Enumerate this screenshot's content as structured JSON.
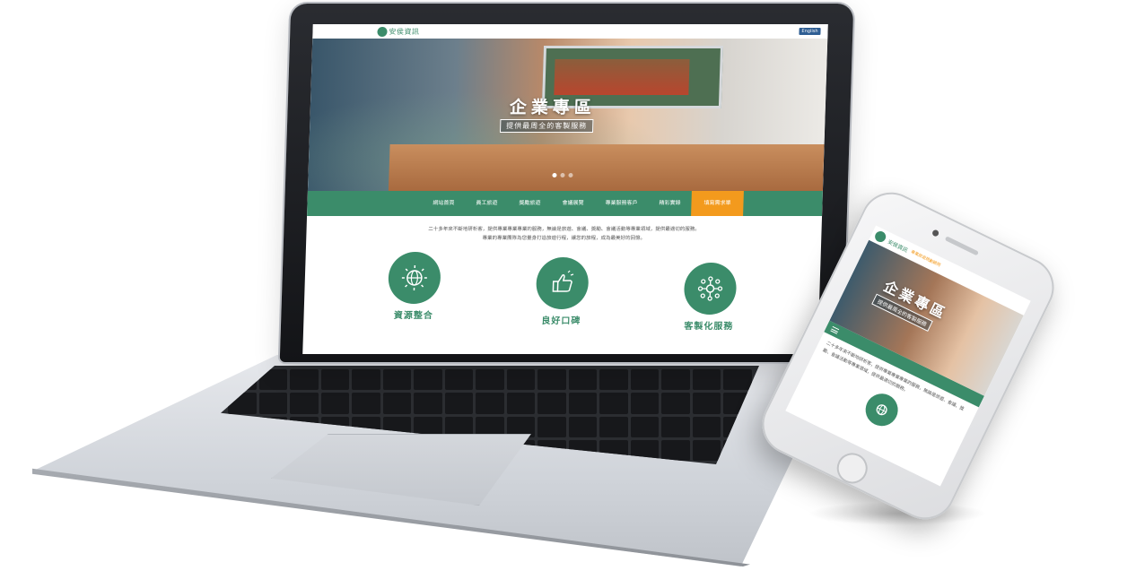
{
  "site": {
    "logo_text": "安侯資訊",
    "lang_button": "English"
  },
  "hero": {
    "title": "企業專區",
    "subtitle": "提供最周全的客製服務"
  },
  "nav": {
    "items": [
      "網站首頁",
      "員工旅遊",
      "獎勵旅遊",
      "會議展覽",
      "專業服務客戶",
      "精彩實錄"
    ],
    "cta": "填寫需求單"
  },
  "intro": {
    "line1": "二十多年來不斷地研析客，提供專業專業專業的服務，無論是旅遊、會議、獎勵、會議活動等專業領域，提供最適切的服務。",
    "line2": "專業的專業團隊為您量身打造旅遊行程，讓您的旅程，成為最美好的回憶。"
  },
  "features": [
    {
      "label": "資源整合",
      "icon": "globe-network-icon"
    },
    {
      "label": "良好口碑",
      "icon": "thumbs-up-icon"
    },
    {
      "label": "客製化服務",
      "icon": "people-network-icon"
    }
  ],
  "phone": {
    "logo_text": "安侯資訊",
    "tagline": "專業旅遊規劃顧問"
  },
  "colors": {
    "brand_green": "#3b8c6a",
    "accent_orange": "#f39a1d",
    "lang_blue": "#2f5e93"
  }
}
